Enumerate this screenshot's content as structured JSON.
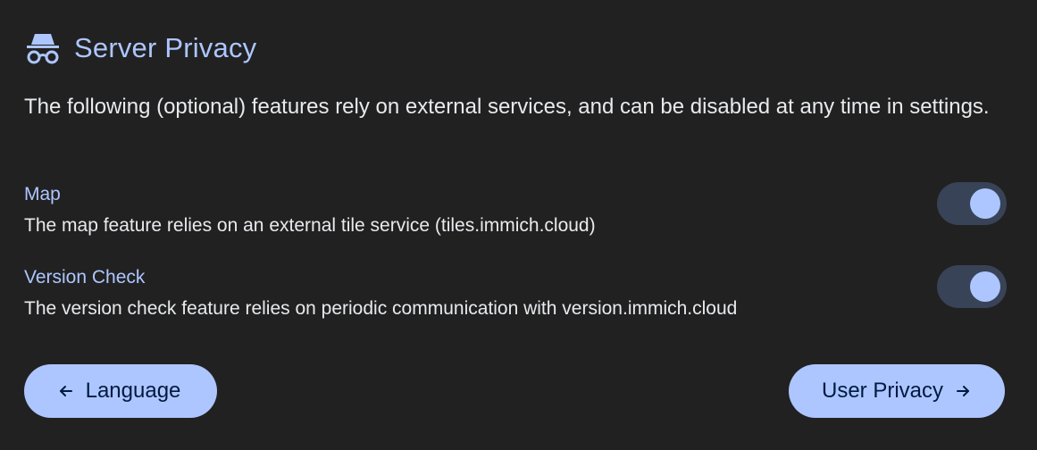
{
  "header": {
    "icon": "incognito-icon",
    "title": "Server Privacy"
  },
  "intro": "The following (optional) features rely on external services, and can be disabled at any time in settings.",
  "settings": [
    {
      "title": "Map",
      "description": "The map feature relies on an external tile service (tiles.immich.cloud)",
      "enabled": true
    },
    {
      "title": "Version Check",
      "description": "The version check feature relies on periodic communication with version.immich.cloud",
      "enabled": true
    }
  ],
  "nav": {
    "back_label": "Language",
    "back_icon": "arrow-left-icon",
    "next_label": "User Privacy",
    "next_icon": "arrow-right-icon"
  },
  "colors": {
    "background": "#212121",
    "accent": "#adc6ff",
    "toggle_track": "#394357",
    "button_text": "#001a41"
  }
}
